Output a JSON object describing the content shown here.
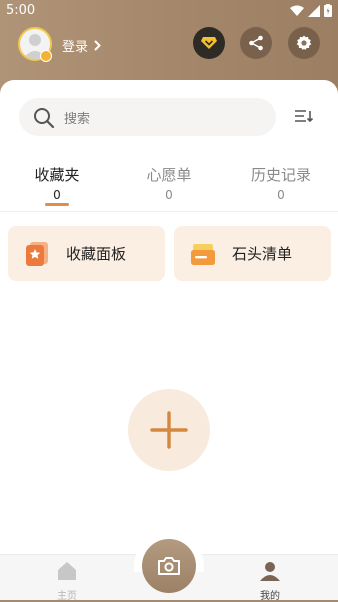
{
  "status_bar": {
    "time": "5:00"
  },
  "header": {
    "login_label": "登录",
    "icons": {
      "vip": "vip-badge-icon",
      "share": "share-icon",
      "settings": "gear-icon"
    }
  },
  "search": {
    "placeholder": "搜索"
  },
  "tabs": [
    {
      "label": "收藏夹",
      "count": "0",
      "active": true
    },
    {
      "label": "心愿单",
      "count": "0",
      "active": false
    },
    {
      "label": "历史记录",
      "count": "0",
      "active": false
    }
  ],
  "tiles": [
    {
      "label": "收藏面板",
      "icon": "bookmark-board-icon"
    },
    {
      "label": "石头清单",
      "icon": "list-folder-icon"
    }
  ],
  "bottom_nav": {
    "home_label": "主页",
    "mine_label": "我的"
  },
  "colors": {
    "header": "#a58a6f",
    "accent": "#e08d4b",
    "tile_bg": "#fbefe4",
    "add_bg": "#f8ebdd"
  }
}
